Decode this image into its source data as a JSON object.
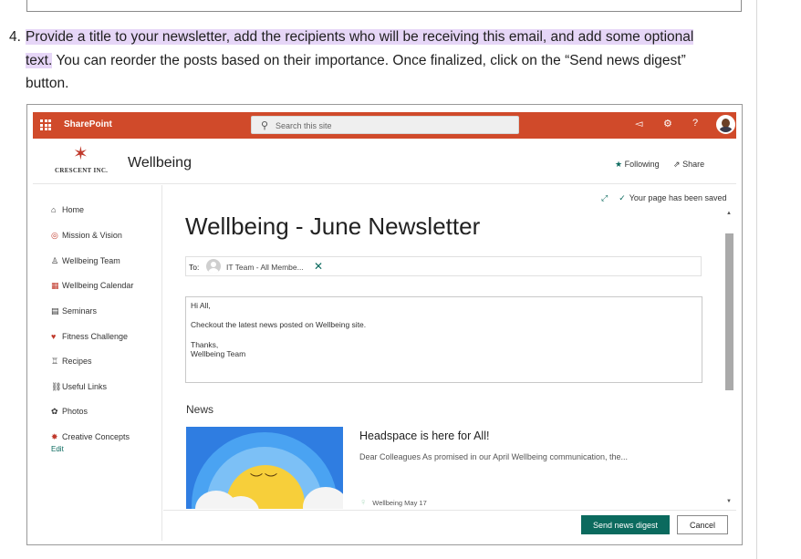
{
  "step": {
    "number": "4.",
    "highlighted_text": "Provide a title to your newsletter, add the recipients who will be receiving this email, and add some optional text.",
    "rest_text": " You can reorder the posts based on their importance. Once finalized, click on the “Send news digest” button."
  },
  "suitebar": {
    "app_name": "SharePoint",
    "search_placeholder": "Search this site",
    "accent": "#d04a2a"
  },
  "site": {
    "logo_text": "CRESCENT INC.",
    "title": "Wellbeing",
    "following_label": "Following",
    "share_label": "Share"
  },
  "nav": {
    "items": [
      {
        "label": "Home",
        "icon": "home-icon"
      },
      {
        "label": "Mission & Vision",
        "icon": "target-icon"
      },
      {
        "label": "Wellbeing Team",
        "icon": "team-icon"
      },
      {
        "label": "Wellbeing Calendar",
        "icon": "calendar-icon"
      },
      {
        "label": "Seminars",
        "icon": "scroll-icon"
      },
      {
        "label": "Fitness Challenge",
        "icon": "heart-icon"
      },
      {
        "label": "Recipes",
        "icon": "chef-icon"
      },
      {
        "label": "Useful Links",
        "icon": "link-icon"
      },
      {
        "label": "Photos",
        "icon": "camera-icon"
      },
      {
        "label": "Creative Concepts",
        "icon": "concept-icon"
      }
    ],
    "edit_label": "Edit"
  },
  "editor": {
    "saved_status": "Your page has been saved",
    "newsletter_title": "Wellbeing - June Newsletter",
    "to_label": "To:",
    "recipient": "IT Team - All Membe...",
    "message": {
      "line1": "Hi All,",
      "line2": "Checkout the latest news posted on Wellbeing site.",
      "line3": "Thanks,",
      "line4": "Wellbeing Team"
    },
    "news_heading": "News",
    "news_item": {
      "title": "Headspace is here for All!",
      "description": "Dear Colleagues As promised in our April Wellbeing communication, the...",
      "author": "Wellbeing",
      "date": "May 17"
    },
    "send_button": "Send news digest",
    "cancel_button": "Cancel",
    "brand_color": "#0b6a5e"
  }
}
